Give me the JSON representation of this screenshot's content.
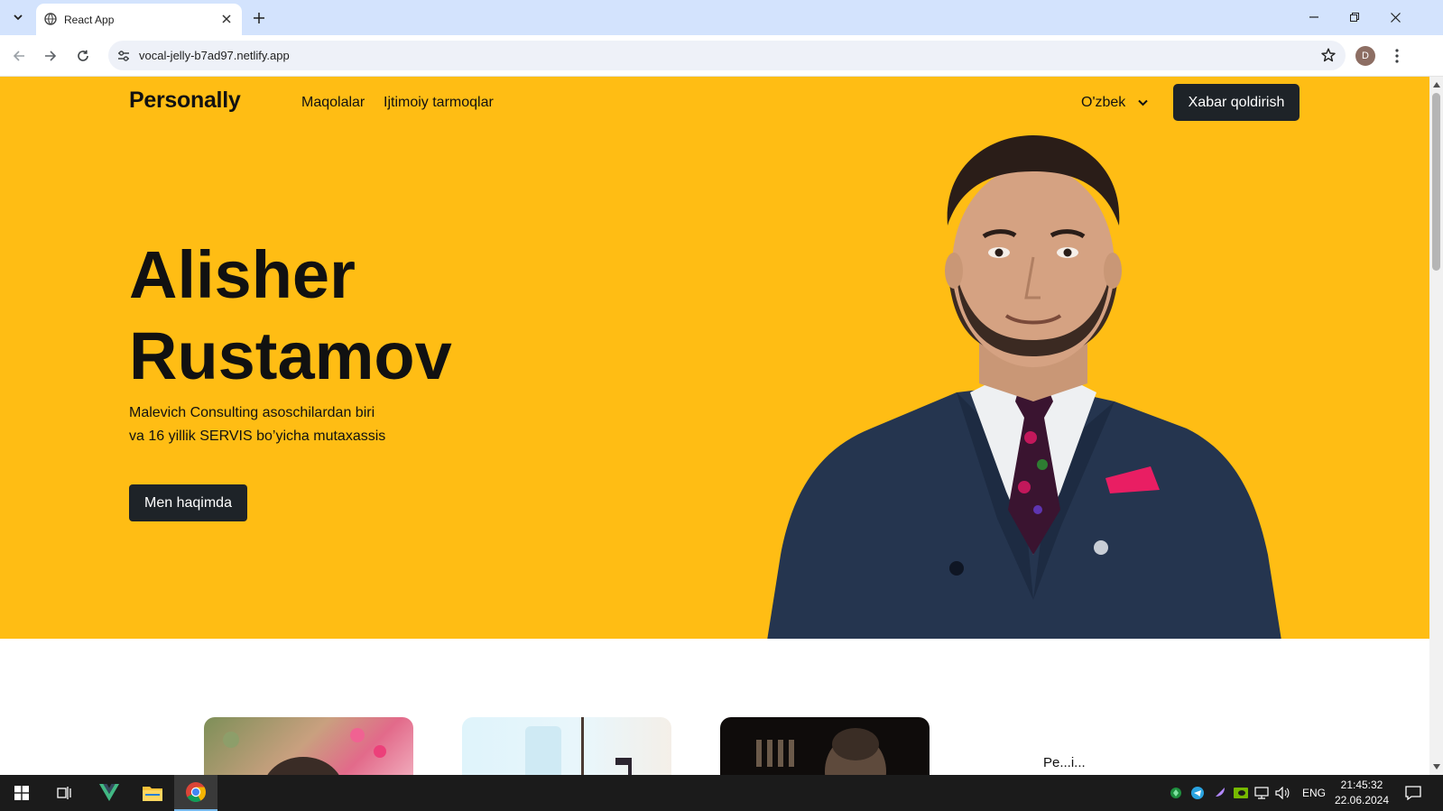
{
  "browser": {
    "tab_title": "React App",
    "url": "vocal-jelly-b7ad97.netlify.app",
    "profile_initial": "D"
  },
  "site": {
    "logo": "Personally",
    "nav": [
      "Maqolalar",
      "Ijtimoiy tarmoqlar"
    ],
    "language": "O'zbek",
    "cta": "Xabar qoldirish",
    "hero": {
      "title_line1": "Alisher",
      "title_line2": "Rustamov",
      "subtitle": "Malevich Consulting asoschilardan biri va 16 yillik SERVIS bo’yicha mutaxassis",
      "button": "Men haqimda"
    },
    "sidebar_heading": "Pe...i..."
  },
  "taskbar": {
    "lang": "ENG",
    "time": "21:45:32",
    "date": "22.06.2024"
  },
  "colors": {
    "hero_bg": "#ffbd14",
    "button_dark": "#1e2328",
    "tabstrip": "#d3e3fd",
    "taskbar": "#1b1b1b"
  }
}
